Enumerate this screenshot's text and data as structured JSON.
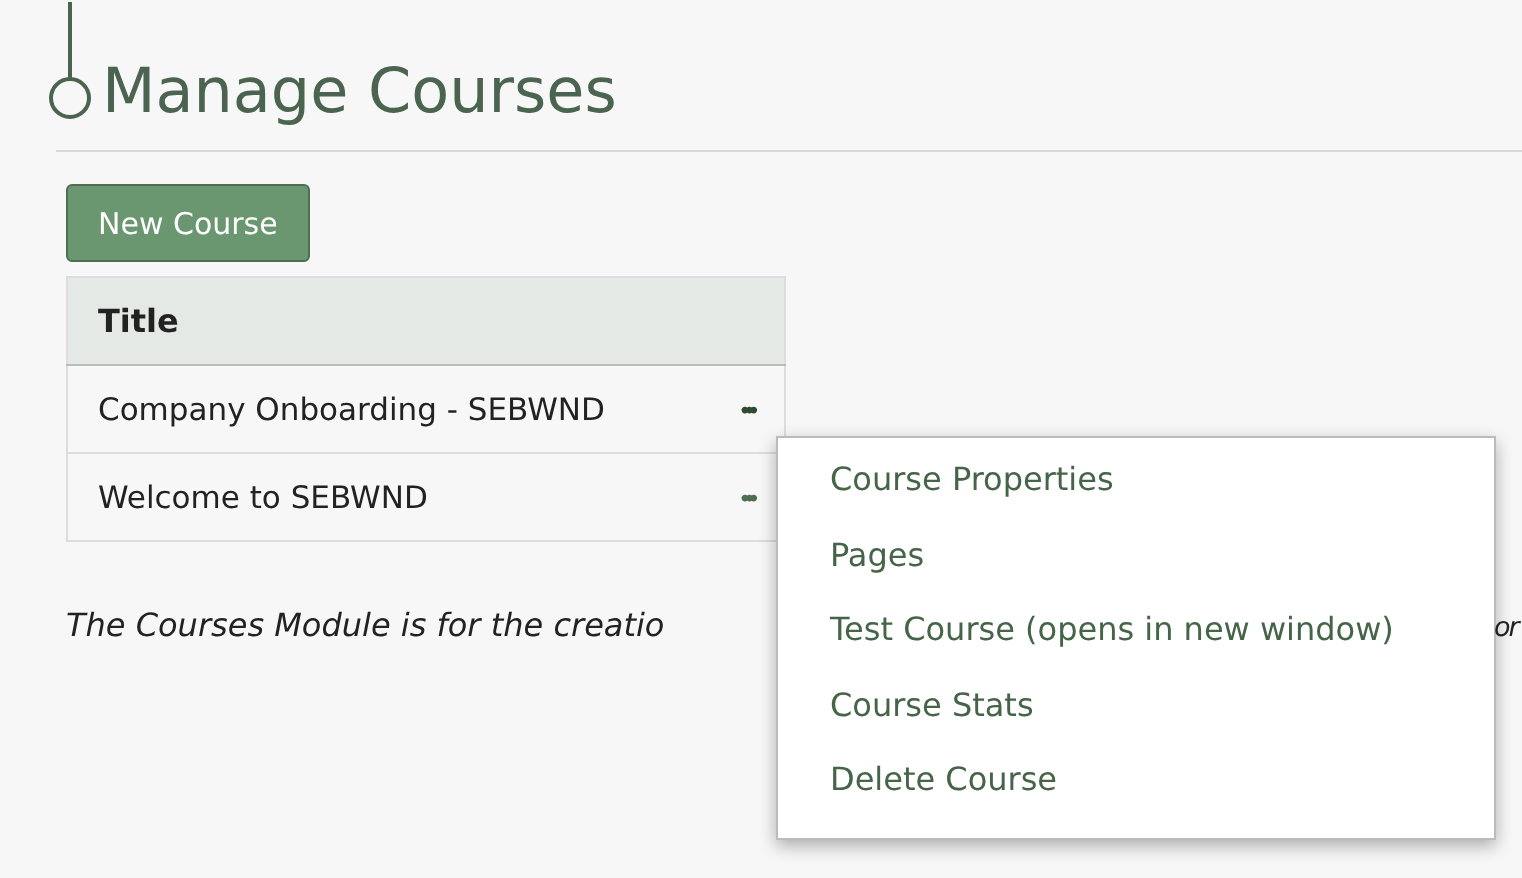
{
  "page": {
    "title": "Manage Courses"
  },
  "new_button": {
    "label": "New Course"
  },
  "table": {
    "columns": [
      "Title"
    ],
    "rows": [
      {
        "title": "Company Onboarding - SEBWND",
        "actions": "•••",
        "menu_open": true
      },
      {
        "title": "Welcome to SEBWND",
        "actions": "•••",
        "menu_open": false
      }
    ]
  },
  "description": {
    "start": "The Courses Module is for the creatio",
    "end": "or"
  },
  "menu": {
    "items": [
      "Course Properties",
      "Pages",
      "Test Course (opens in new window)",
      "Course Stats",
      "Delete Course"
    ]
  }
}
